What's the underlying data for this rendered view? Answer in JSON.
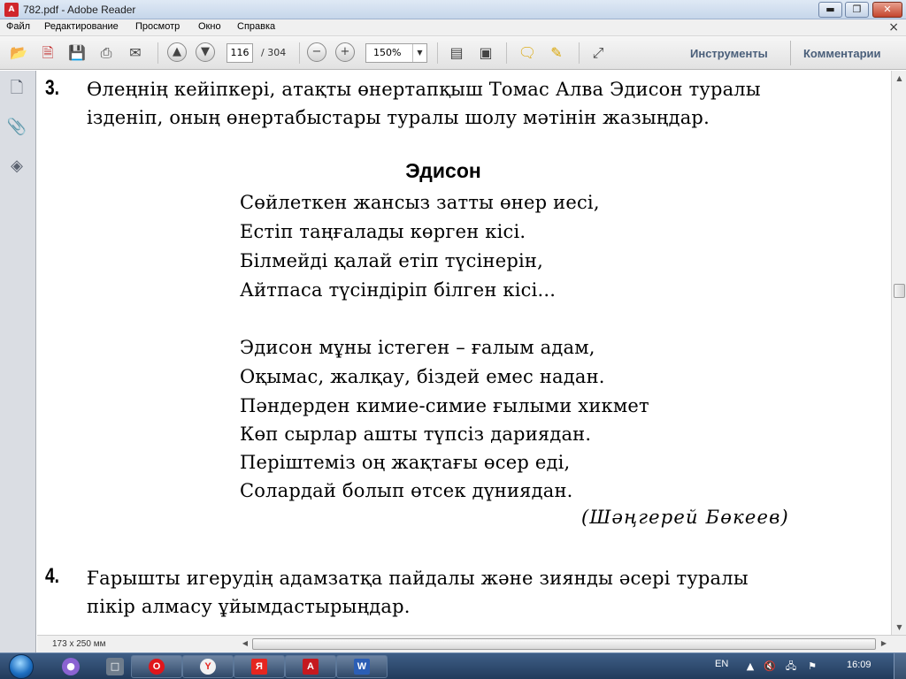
{
  "window": {
    "title": "782.pdf - Adobe Reader",
    "buttons": {
      "minimize": "▬",
      "maximize": "❐",
      "close": "✕"
    }
  },
  "menu": {
    "items": [
      "Файл",
      "Редактирование",
      "Просмотр",
      "Окно",
      "Справка"
    ],
    "close_doc": "×"
  },
  "toolbar": {
    "page_current": "116",
    "page_total": "/ 304",
    "zoom": "150%",
    "tools_label": "Инструменты",
    "comments_label": "Комментарии",
    "icons": [
      "open-icon",
      "create-pdf-icon",
      "save-icon",
      "print-icon",
      "email-icon",
      "prev-page-icon",
      "next-page-icon",
      "zoom-out-icon",
      "zoom-in-icon",
      "fit-page-icon",
      "fit-width-icon",
      "comment-icon",
      "highlight-icon",
      "fullscreen-icon"
    ]
  },
  "navpane": {
    "icons": [
      "pages-icon",
      "attachments-icon",
      "layers-icon"
    ]
  },
  "document": {
    "q3_number": "3.",
    "q3_lines": [
      "Өлеңнің кейіпкері, атақты өнертапқыш Томас Алва Эдисон туралы",
      "ізденіп, оның өнертабыстары туралы шолу мәтінін жазыңдар."
    ],
    "poem_title": "Эдисон",
    "poem_lines": [
      "Сөйлеткен жансыз затты өнер иесі,",
      "Естіп таңғалады көрген кісі.",
      "Білмейді қалай етіп түсінерін,",
      "Айтпаса түсіндіріп білген кісі...",
      "Эдисон мұны істеген – ғалым адам,",
      "Оқымас, жалқау, біздей емес надан.",
      "Пәндерден кимие-симие ғылыми хикмет",
      "Көп сырлар ашты түпсіз дариядан.",
      "Періштеміз оң жақтағы өсер еді,",
      "Солардай болып өтсек дүниядан."
    ],
    "author": "(Шәңгерей Бөкеев)",
    "q4_number": "4.",
    "q4_lines": [
      "Ғарышты игерудің адамзатқа пайдалы және зиянды әсері туралы",
      "пікір алмасу ұйымдастырыңдар."
    ]
  },
  "status": {
    "page_size": "173 x 250 мм"
  },
  "taskbar": {
    "tray_lang": "EN",
    "clock": "16:09",
    "apps": [
      "opera-icon",
      "yandex-browser-icon",
      "yandex-icon",
      "adobe-reader-icon",
      "word-icon"
    ]
  }
}
